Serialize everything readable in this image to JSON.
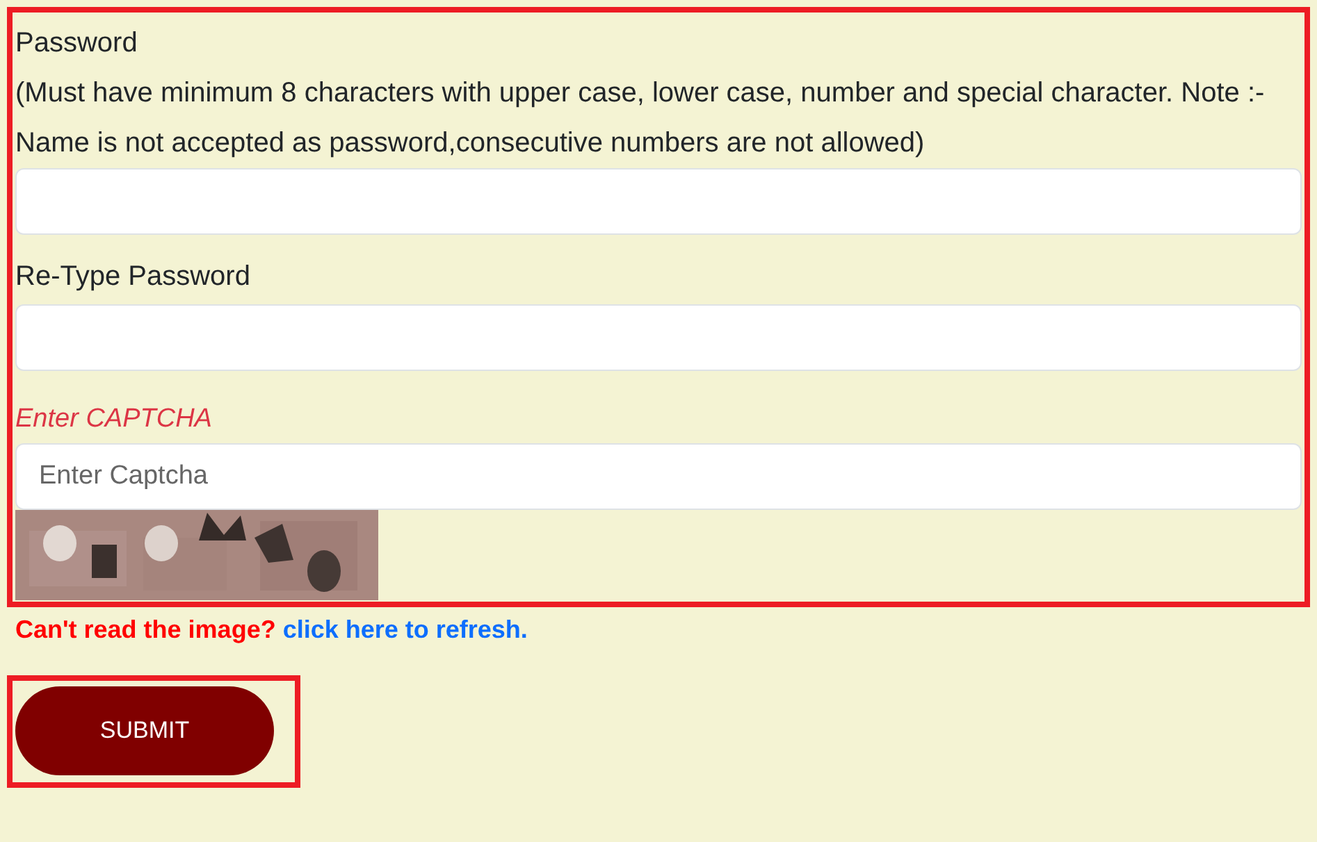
{
  "password": {
    "label": "Password",
    "hint": "(Must have minimum 8 characters with upper case, lower case, number and special character. Note :- Name is not accepted as password,consecutive numbers are not allowed)"
  },
  "retype_password": {
    "label": "Re-Type Password"
  },
  "captcha": {
    "label": "Enter CAPTCHA",
    "placeholder": "Enter Captcha"
  },
  "refresh": {
    "text": "Can't read the image?",
    "link": "click here to refresh."
  },
  "submit_button": {
    "label": "SUBMIT"
  }
}
